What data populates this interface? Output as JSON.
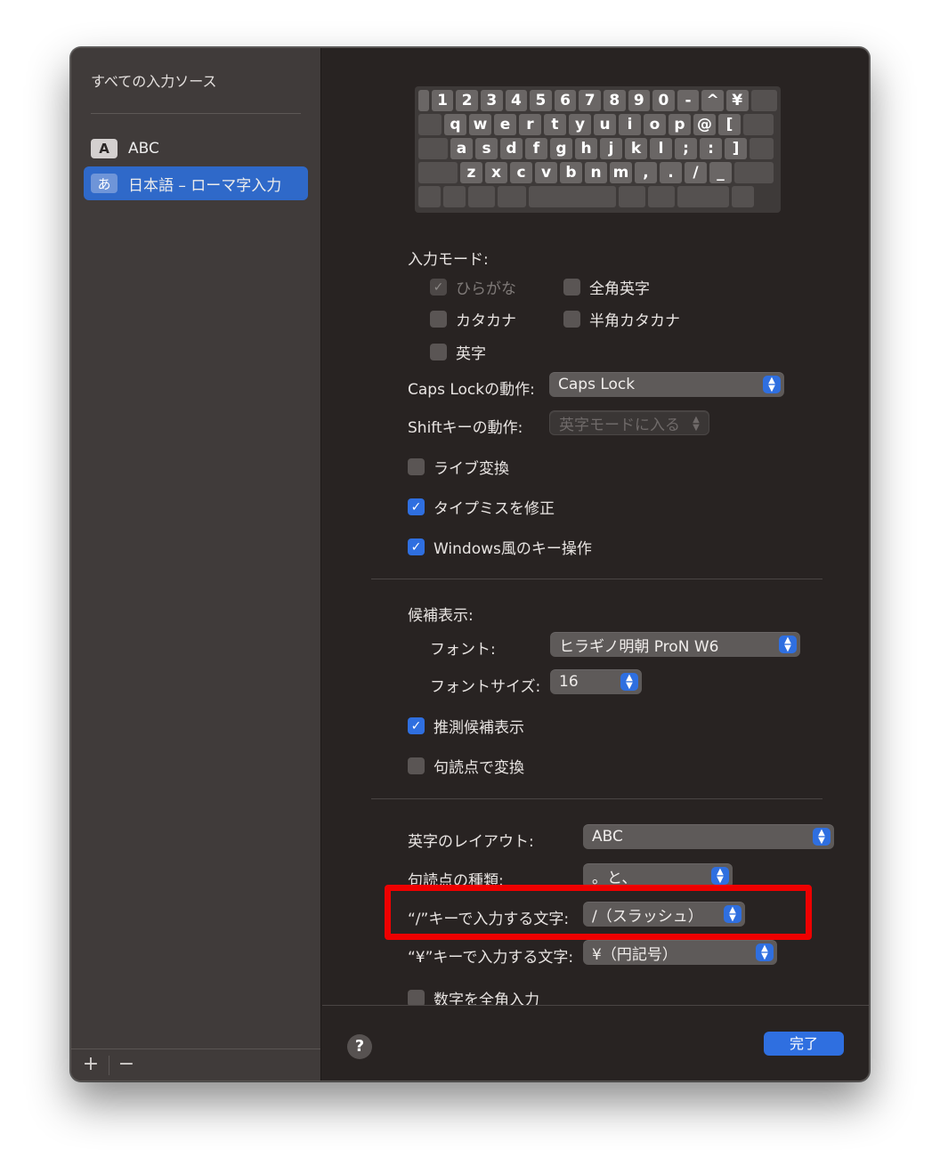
{
  "sidebar": {
    "heading": "すべての入力ソース",
    "items": [
      {
        "badge": "A",
        "label": "ABC",
        "selected": false
      },
      {
        "badge": "あ",
        "label": "日本語 – ローマ字入力",
        "selected": true
      }
    ],
    "add_label": "+",
    "remove_label": "−"
  },
  "keyboard": {
    "rows": [
      [
        "1",
        "2",
        "3",
        "4",
        "5",
        "6",
        "7",
        "8",
        "9",
        "0",
        "-",
        "^",
        "¥",
        ""
      ],
      [
        "",
        "q",
        "w",
        "e",
        "r",
        "t",
        "y",
        "u",
        "i",
        "o",
        "p",
        "@",
        "[",
        ""
      ],
      [
        "",
        "a",
        "s",
        "d",
        "f",
        "g",
        "h",
        "j",
        "k",
        "l",
        ";",
        ":",
        "]",
        ""
      ],
      [
        "",
        "z",
        "x",
        "c",
        "v",
        "b",
        "n",
        "m",
        ",",
        ".",
        "/",
        "_",
        ""
      ],
      [
        "",
        "",
        "",
        "",
        "",
        "",
        "",
        "",
        ""
      ]
    ]
  },
  "input_mode": {
    "label": "入力モード:",
    "options": {
      "hiragana": {
        "label": "ひらがな",
        "checked": true,
        "disabled": true
      },
      "zenkaku_eiji": {
        "label": "全角英字",
        "checked": false
      },
      "katakana": {
        "label": "カタカナ",
        "checked": false
      },
      "hankaku_katakana": {
        "label": "半角カタカナ",
        "checked": false
      },
      "eiji": {
        "label": "英字",
        "checked": false
      }
    }
  },
  "caps_lock": {
    "label": "Caps Lockの動作:",
    "value": "Caps Lock"
  },
  "shift": {
    "label": "Shiftキーの動作:",
    "value": "英字モードに入る"
  },
  "options": {
    "live_conversion": {
      "label": "ライブ変換",
      "checked": false
    },
    "typo_fix": {
      "label": "タイプミスを修正",
      "checked": true
    },
    "windows_keys": {
      "label": "Windows風のキー操作",
      "checked": true
    }
  },
  "candidates": {
    "label": "候補表示:",
    "font_label": "フォント:",
    "font_value": "ヒラギノ明朝 ProN W6",
    "font_size_label": "フォントサイズ:",
    "font_size_value": "16",
    "predictive": {
      "label": "推測候補表示",
      "checked": true
    },
    "punct_convert": {
      "label": "句読点で変換",
      "checked": false
    }
  },
  "layout": {
    "label": "英字のレイアウト:",
    "value": "ABC",
    "punct_type_label": "句読点の種類:",
    "punct_type_value": "。と、",
    "slash_label": "“/”キーで入力する文字:",
    "slash_value": "/（スラッシュ）",
    "yen_label": "“¥”キーで入力する文字:",
    "yen_value": "¥（円記号）",
    "fullwidth_numbers": {
      "label": "数字を全角入力",
      "checked": false
    }
  },
  "footer": {
    "help_label": "?",
    "done_label": "完了"
  },
  "colors": {
    "accent": "#2f6fe0",
    "highlight": "#ee0000",
    "panel": "#282322",
    "sidebar": "#403b3a"
  }
}
